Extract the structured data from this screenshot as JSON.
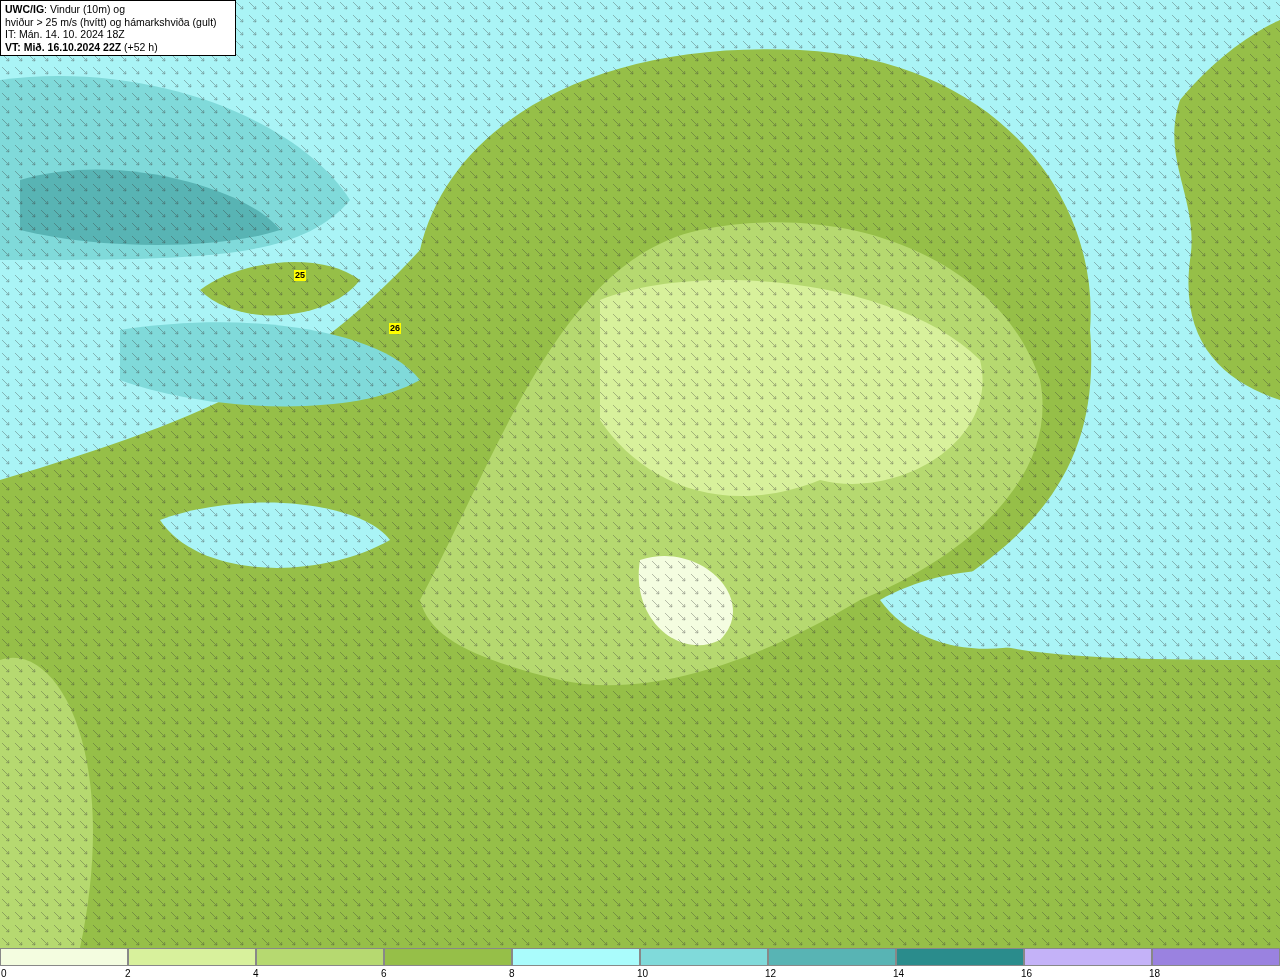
{
  "title_box": {
    "lines": [
      "**UWC/IG**: Vindur (10m) og",
      "hviður > 25 m/s (hvítt) og hámarkshviða (gult)",
      "IT: Mán. 14. 10. 2024 18Z",
      "**VT: Mið. 16.10.2024 22Z** (+52 h)"
    ]
  },
  "map": {
    "gust_markers": [
      {
        "label": "25"
      },
      {
        "label": "26"
      }
    ]
  },
  "legend": {
    "bins": [
      {
        "label": "0",
        "color": "#f4fde0"
      },
      {
        "label": "2",
        "color": "#d8f19c"
      },
      {
        "label": "4",
        "color": "#b6d970"
      },
      {
        "label": "6",
        "color": "#96bf48"
      },
      {
        "label": "8",
        "color": "#aafcfc"
      },
      {
        "label": "10",
        "color": "#80dada"
      },
      {
        "label": "12",
        "color": "#58b4b4"
      },
      {
        "label": "14",
        "color": "#2a8c8c"
      },
      {
        "label": "16",
        "color": "#c4b2f8"
      },
      {
        "label": "18",
        "color": "#9a82e0"
      }
    ]
  }
}
